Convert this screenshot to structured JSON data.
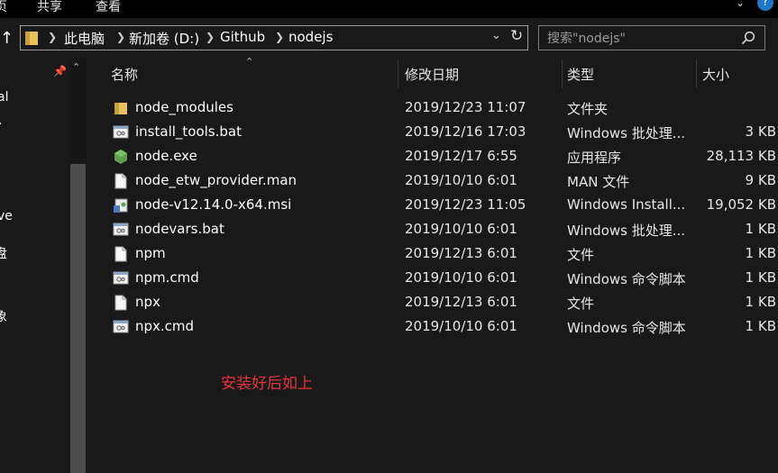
{
  "ribbon": {
    "tabs": [
      "页",
      "共享",
      "查看"
    ]
  },
  "address_bar": {
    "crumbs": [
      "此电脑",
      "新加卷 (D:)",
      "Github",
      "nodejs"
    ]
  },
  "search": {
    "placeholder": "搜索\"nodejs\""
  },
  "nav_pane": {
    "items": [
      "al",
      "·",
      "ve",
      "盘",
      "象"
    ]
  },
  "columns": {
    "name": "名称",
    "date": "修改日期",
    "type": "类型",
    "size": "大小"
  },
  "files": [
    {
      "name": "node_modules",
      "date": "2019/12/23 11:07",
      "type": "文件夹",
      "size": "",
      "icon": "folder-icon"
    },
    {
      "name": "install_tools.bat",
      "date": "2019/12/16 17:03",
      "type": "Windows 批处理...",
      "size": "3 KB",
      "icon": "batch-file-icon"
    },
    {
      "name": "node.exe",
      "date": "2019/12/17 6:55",
      "type": "应用程序",
      "size": "28,113 KB",
      "icon": "node-exe-icon"
    },
    {
      "name": "node_etw_provider.man",
      "date": "2019/10/10 6:01",
      "type": "MAN 文件",
      "size": "9 KB",
      "icon": "file-icon"
    },
    {
      "name": "node-v12.14.0-x64.msi",
      "date": "2019/12/23 11:05",
      "type": "Windows Install...",
      "size": "19,052 KB",
      "icon": "msi-installer-icon"
    },
    {
      "name": "nodevars.bat",
      "date": "2019/10/10 6:01",
      "type": "Windows 批处理...",
      "size": "1 KB",
      "icon": "batch-file-icon"
    },
    {
      "name": "npm",
      "date": "2019/12/13 6:01",
      "type": "文件",
      "size": "1 KB",
      "icon": "file-icon"
    },
    {
      "name": "npm.cmd",
      "date": "2019/10/10 6:01",
      "type": "Windows 命令脚本",
      "size": "1 KB",
      "icon": "batch-file-icon"
    },
    {
      "name": "npx",
      "date": "2019/12/13 6:01",
      "type": "文件",
      "size": "1 KB",
      "icon": "file-icon"
    },
    {
      "name": "npx.cmd",
      "date": "2019/10/10 6:01",
      "type": "Windows 命令脚本",
      "size": "1 KB",
      "icon": "batch-file-icon"
    }
  ],
  "annotation": "安装好后如上",
  "colors": {
    "background": "#191919",
    "annotation": "#e6343b",
    "help_button": "#1f75c9",
    "folder": "#e8c15a",
    "node_green": "#5fa04e"
  }
}
